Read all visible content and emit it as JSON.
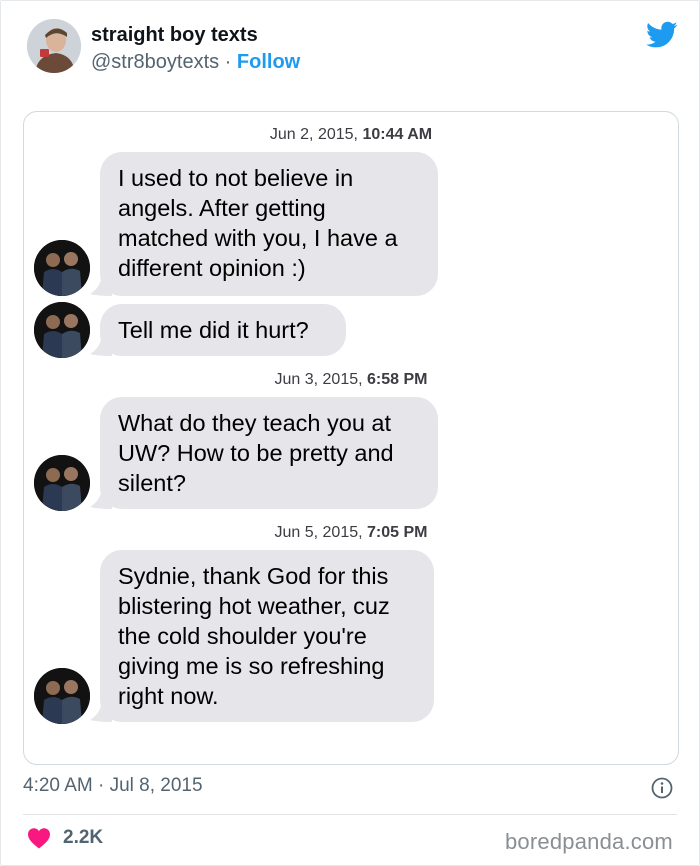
{
  "author": {
    "display_name": "straight boy texts",
    "handle": "@str8boytexts",
    "separator": " · ",
    "follow_label": "Follow"
  },
  "brand_color": "#1d9bf0",
  "conversation": {
    "groups": [
      {
        "timestamp_day": "Jun 2, 2015,",
        "timestamp_time": "10:44 AM",
        "messages": [
          "I used to not believe in angels. After getting matched with you, I have a different opinion :)",
          "Tell me did it hurt?"
        ]
      },
      {
        "timestamp_day": "Jun 3, 2015,",
        "timestamp_time": "6:58 PM",
        "messages": [
          "What do they teach you at UW? How to be pretty and silent?"
        ]
      },
      {
        "timestamp_day": "Jun 5, 2015,",
        "timestamp_time": "7:05 PM",
        "messages": [
          "Sydnie, thank God for this blistering hot weather, cuz the cold shoulder you're giving me is so refreshing right now."
        ]
      }
    ]
  },
  "tweet": {
    "posted_at": "4:20 AM · Jul 8, 2015",
    "likes": "2.2K"
  },
  "watermark": "boredpanda.com",
  "icons": {
    "brand": "twitter-bird-icon",
    "info": "info-icon",
    "like": "heart-icon"
  }
}
